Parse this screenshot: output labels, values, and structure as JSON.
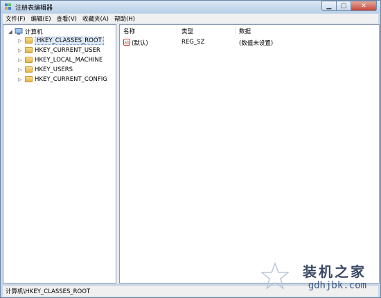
{
  "window": {
    "title": "注册表编辑器"
  },
  "menu": [
    "文件(F)",
    "编辑(E)",
    "查看(V)",
    "收藏夹(A)",
    "帮助(H)"
  ],
  "tree": {
    "root": "计算机",
    "children": [
      "HKEY_CLASSES_ROOT",
      "HKEY_CURRENT_USER",
      "HKEY_LOCAL_MACHINE",
      "HKEY_USERS",
      "HKEY_CURRENT_CONFIG"
    ]
  },
  "list": {
    "columns": [
      "名称",
      "类型",
      "数据"
    ],
    "rows": [
      {
        "name": "(默认)",
        "type": "REG_SZ",
        "data": "(数值未设置)"
      }
    ]
  },
  "status": "计算机\\HKEY_CLASSES_ROOT",
  "watermark": {
    "title": "装机之家",
    "url": "gdhjbk.com"
  }
}
